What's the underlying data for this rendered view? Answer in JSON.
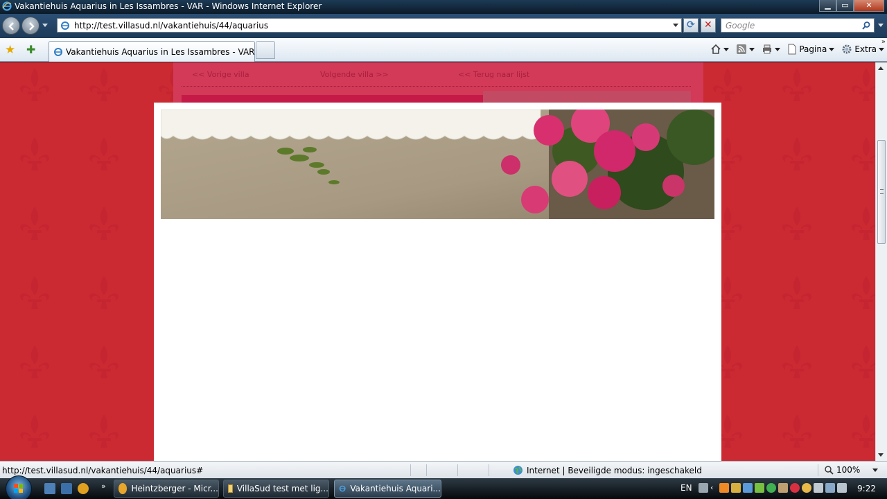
{
  "window": {
    "title": "Vakantiehuis Aquarius in Les Issambres - VAR - Windows Internet Explorer",
    "buttons": {
      "minimize": "▁",
      "maximize": "▭",
      "close": "✕"
    }
  },
  "address_bar": {
    "url": "http://test.villasud.nl/vakantiehuis/44/aquarius",
    "search_placeholder": "Google"
  },
  "tabs": [
    {
      "label": "Vakantiehuis Aquarius in Les Issambres - VAR",
      "active": true
    }
  ],
  "toolbar": {
    "page_label": "Pagina",
    "extra_label": "Extra",
    "overflow": "»"
  },
  "page": {
    "villa_nav": {
      "prev": "<< Vorige villa",
      "next": "Volgende villa >>",
      "back": "<< Terug naar lijst"
    },
    "colors": {
      "background": "#cc2a32",
      "panel": "#d23a58",
      "overlay": "#ffffff"
    }
  },
  "statusbar": {
    "link": "http://test.villasud.nl/vakantiehuis/44/aquarius#",
    "zone": "Internet | Beveiligde modus: ingeschakeld",
    "zoom": "100%"
  },
  "taskbar": {
    "buttons": [
      {
        "label": "Heintzberger - Micr...",
        "icon": "messenger-icon"
      },
      {
        "label": "VillaSud test met lig...",
        "icon": "mail-icon"
      },
      {
        "label": "Vakantiehuis Aquari...",
        "icon": "ie-icon",
        "active": true
      }
    ],
    "overflow": "»",
    "language": "EN",
    "clock": "9:22"
  }
}
